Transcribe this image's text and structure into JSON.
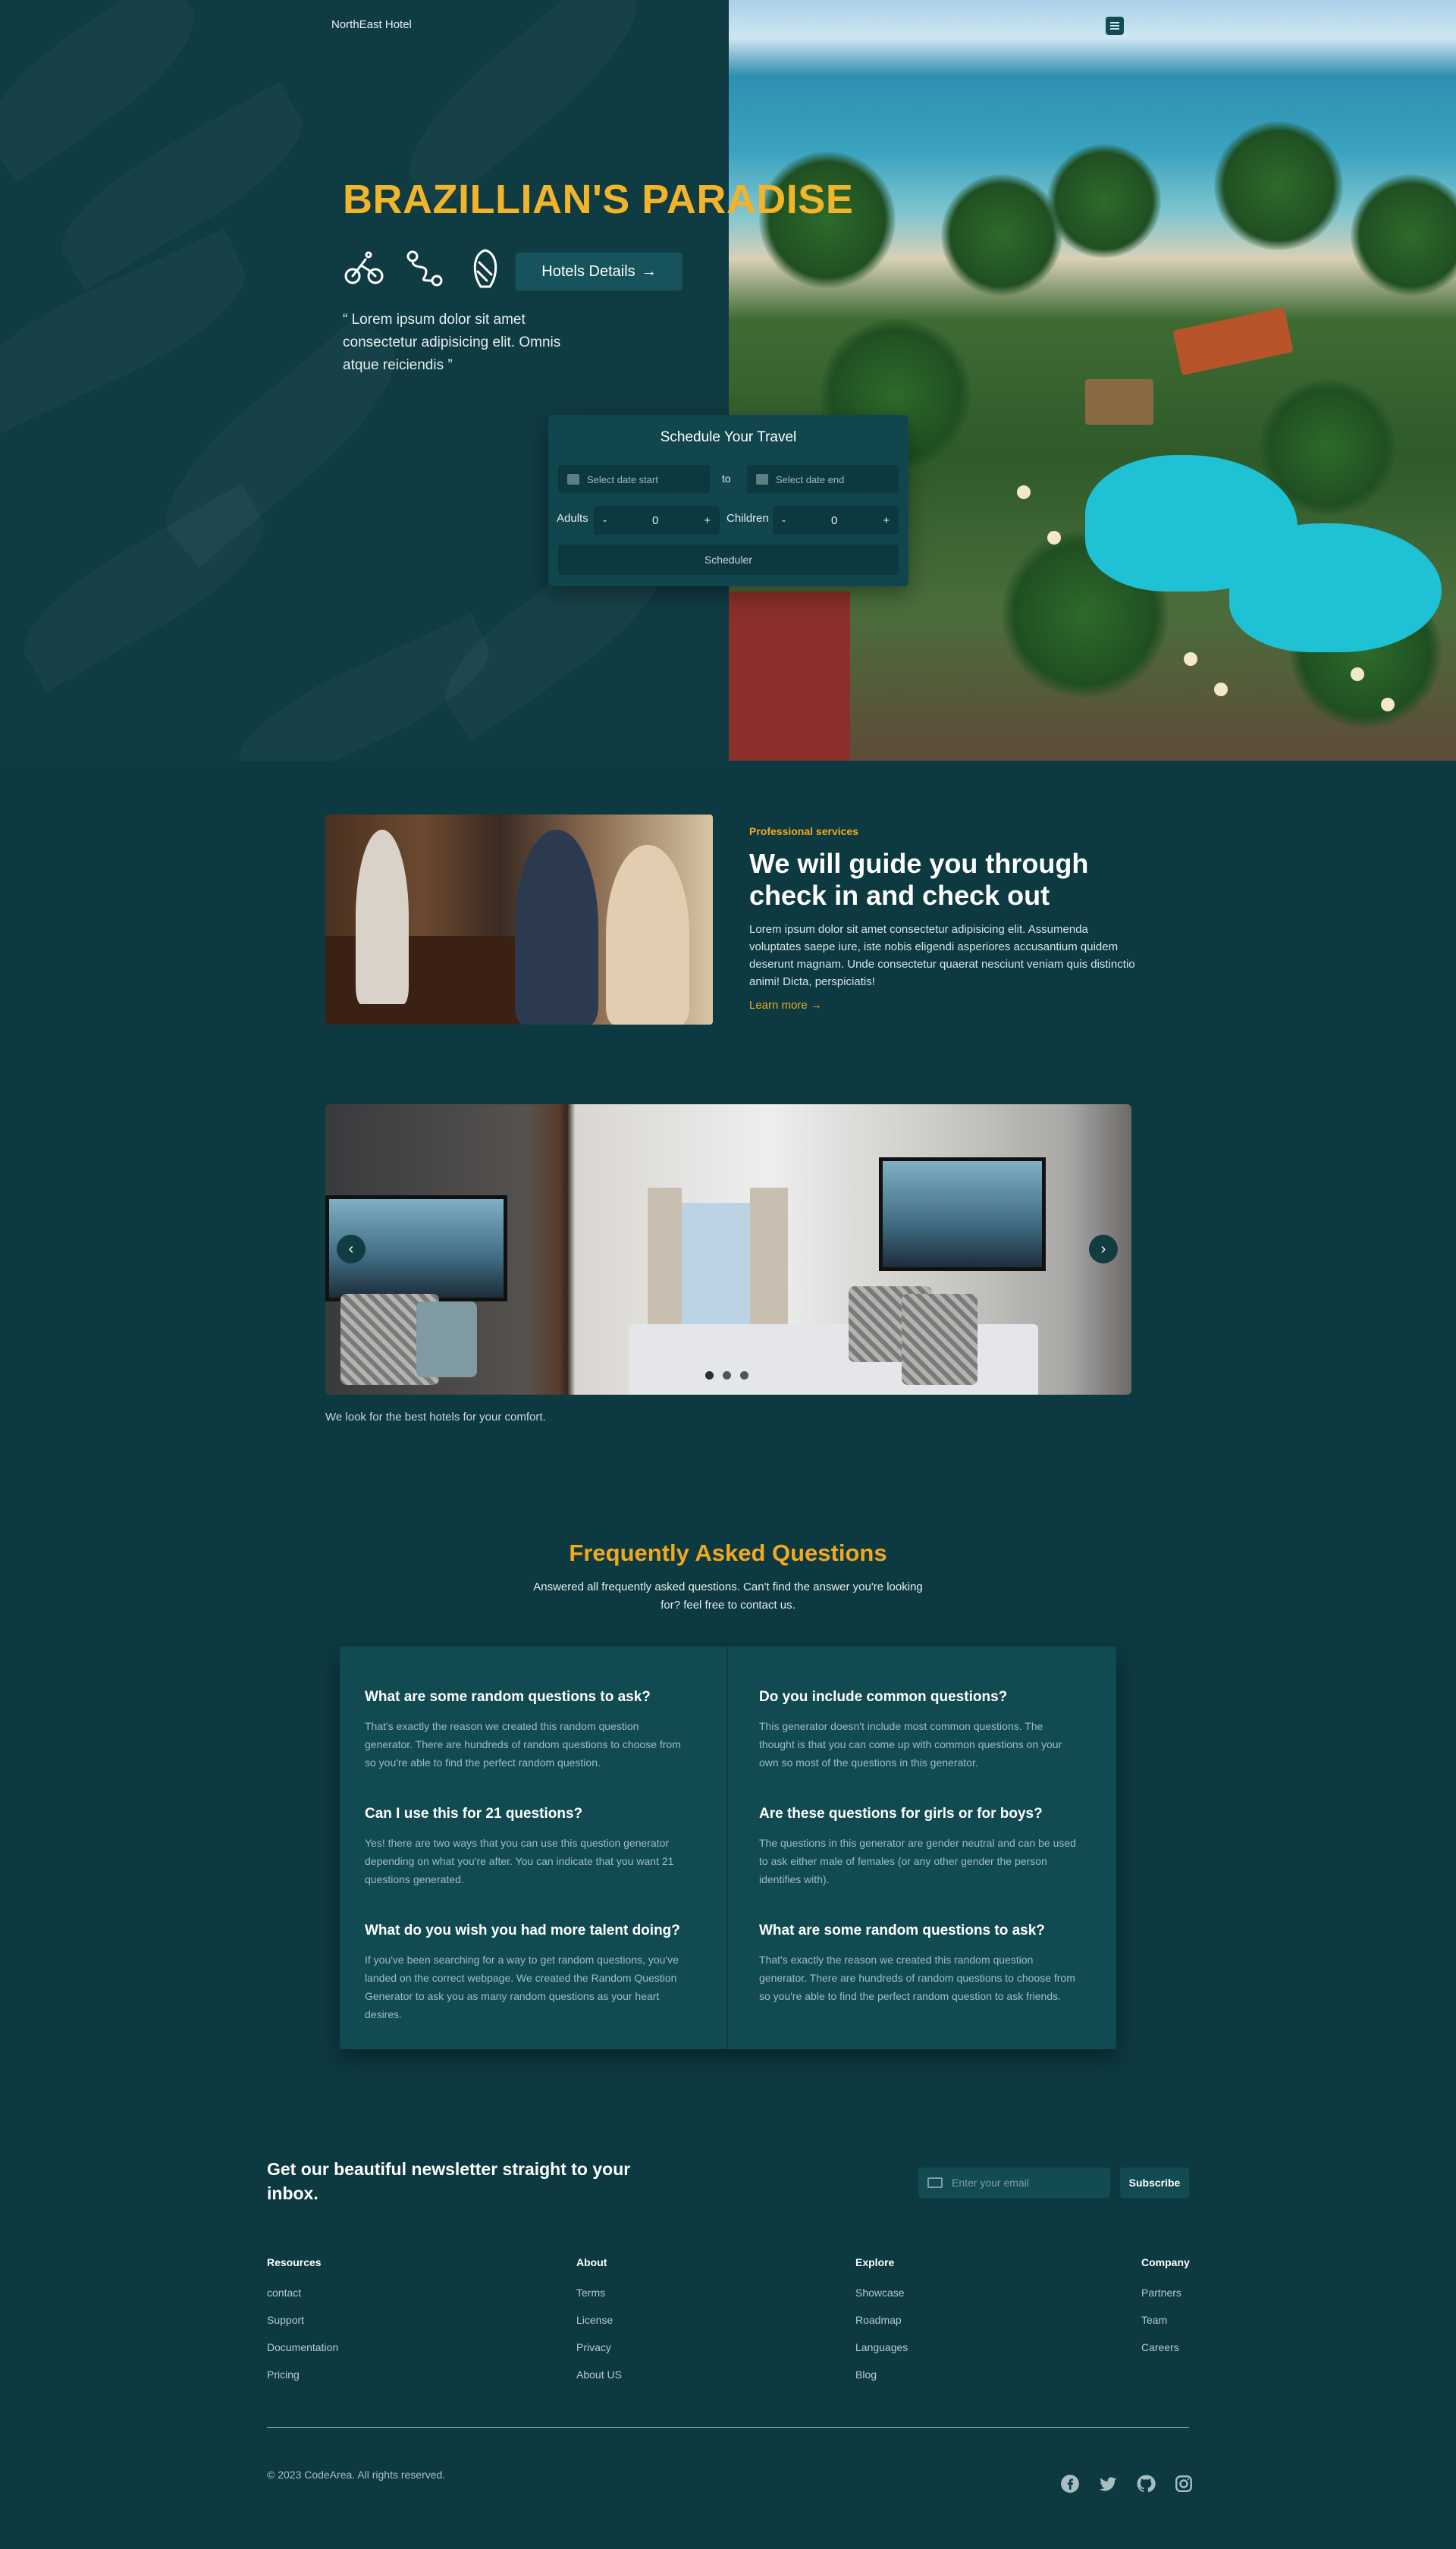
{
  "header": {
    "brand": "NorthEast Hotel"
  },
  "hero": {
    "title": "BRAZILLIAN'S PARADISE",
    "details_button": "Hotels Details",
    "quote": "“ Lorem ipsum dolor sit amet consectetur adipisicing elit. Omnis atque reiciendis ”",
    "icons": [
      "bike-icon",
      "route-icon",
      "surfboard-icon"
    ]
  },
  "scheduler": {
    "title": "Schedule Your Travel",
    "start_placeholder": "Select date start",
    "to_label": "to",
    "end_placeholder": "Select date end",
    "adults_label": "Adults",
    "adults_value": "0",
    "children_label": "Children",
    "children_value": "0",
    "minus": "-",
    "plus": "+",
    "button": "Scheduler"
  },
  "services": {
    "eyebrow": "Professional services",
    "title": "We will guide you through check in and check out",
    "text": "Lorem ipsum dolor sit amet consectetur adipisicing elit. Assumenda voluptates saepe iure, iste nobis eligendi asperiores accusantium quidem deserunt magnam. Unde consectetur quaerat nesciunt veniam quis distinctio animi! Dicta, perspiciatis!",
    "link": "Learn more"
  },
  "carousel": {
    "caption": "We look for the best hotels for your comfort.",
    "slide_count": 3,
    "active_slide": 1
  },
  "faq": {
    "title": "Frequently Asked Questions",
    "subtitle": "Answered all frequently asked questions. Can't find the answer you're looking for? feel free to contact us.",
    "items": [
      {
        "q": "What are some random questions to ask?",
        "a": "That's exactly the reason we created this random question generator. There are hundreds of random questions to choose from so you're able to find the perfect random question."
      },
      {
        "q": "Do you include common questions?",
        "a": "This generator doesn't include most common questions. The thought is that you can come up with common questions on your own so most of the questions in this generator."
      },
      {
        "q": "Can I use this for 21 questions?",
        "a": "Yes! there are two ways that you can use this question generator depending on what you're after. You can indicate that you want 21 questions generated."
      },
      {
        "q": "Are these questions for girls or for boys?",
        "a": "The questions in this generator are gender neutral and can be used to ask either male of females (or any other gender the person identifies with)."
      },
      {
        "q": "What do you wish you had more talent doing?",
        "a": "If you've been searching for a way to get random questions, you've landed on the correct webpage. We created the Random Question Generator to ask you as many random questions as your heart desires."
      },
      {
        "q": "What are some random questions to ask?",
        "a": "That's exactly the reason we created this random question generator. There are hundreds of random questions to choose from so you're able to find the perfect random question to ask friends."
      }
    ]
  },
  "newsletter": {
    "title": "Get our beautiful newsletter straight to your inbox.",
    "placeholder": "Enter your email",
    "button": "Subscribe"
  },
  "footer": {
    "columns": [
      {
        "title": "Resources",
        "links": [
          "contact",
          "Support",
          "Documentation",
          "Pricing"
        ]
      },
      {
        "title": "About",
        "links": [
          "Terms",
          "License",
          "Privacy",
          "About US"
        ]
      },
      {
        "title": "Explore",
        "links": [
          "Showcase",
          "Roadmap",
          "Languages",
          "Blog"
        ]
      },
      {
        "title": "Company",
        "links": [
          "Partners",
          "Team",
          "Careers"
        ]
      }
    ],
    "copyright": "© 2023 CodeArea. All rights reserved.",
    "socials": [
      "facebook-icon",
      "twitter-icon",
      "github-icon",
      "instagram-icon"
    ]
  },
  "colors": {
    "background": "#0d3940",
    "accent": "#f2a91e",
    "hero_title": "#f2b42b",
    "card": "#124a52"
  }
}
